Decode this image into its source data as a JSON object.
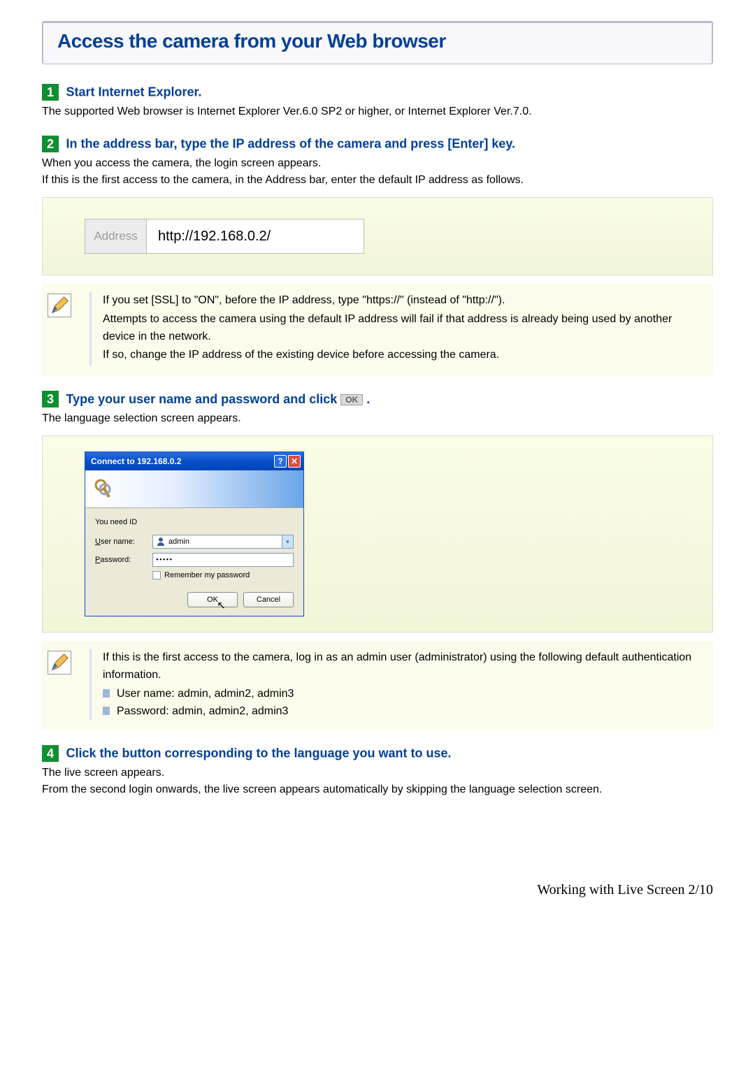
{
  "page_title": "Access the camera from your Web browser",
  "steps": [
    {
      "num": "1",
      "heading": "Start Internet Explorer.",
      "body": "The supported Web browser is Internet Explorer Ver.6.0 SP2 or higher, or Internet Explorer Ver.7.0."
    },
    {
      "num": "2",
      "heading": "In the address bar, type the IP address of the camera and press [Enter] key.",
      "body1": "When you access the camera, the login screen appears.",
      "body2": "If this is the first access to the camera, in the Address bar, enter the default IP address as follows."
    },
    {
      "num": "3",
      "heading": "Type your user name and password and click",
      "after_ok": ".",
      "body": "The language selection screen appears."
    },
    {
      "num": "4",
      "heading": "Click the button corresponding to the language you want to use.",
      "body1": "The live screen appears.",
      "body2": "From the second login onwards, the live screen appears automatically by skipping the language selection screen."
    }
  ],
  "address_bar": {
    "label": "Address",
    "value": "http://192.168.0.2/"
  },
  "note1": {
    "line1": "If you set [SSL] to \"ON\", before the IP address, type \"https://\" (instead of \"http://\").",
    "line2": "Attempts to access the camera using the default IP address will fail if that address is already being used by another device in the network.",
    "line3": "If so, change the IP address of the existing device before accessing the camera."
  },
  "note2": {
    "intro": "If this is the first access to the camera, log in as an admin user (administrator) using the following default authentication information.",
    "items": [
      "User name: admin, admin2, admin3",
      "Password: admin, admin2, admin3"
    ]
  },
  "login_dialog": {
    "title": "Connect to 192.168.0.2",
    "need": "You need ID",
    "user_label_pre": "U",
    "user_label_rest": "ser name:",
    "pass_label_pre": "P",
    "pass_label_rest": "assword:",
    "user_value": "admin",
    "pass_value": "•••••",
    "remember_pre": "R",
    "remember_rest": "emember my password",
    "ok": "OK",
    "cancel": "Cancel"
  },
  "ok_inline": "OK",
  "footer": "Working with Live Screen 2/10"
}
